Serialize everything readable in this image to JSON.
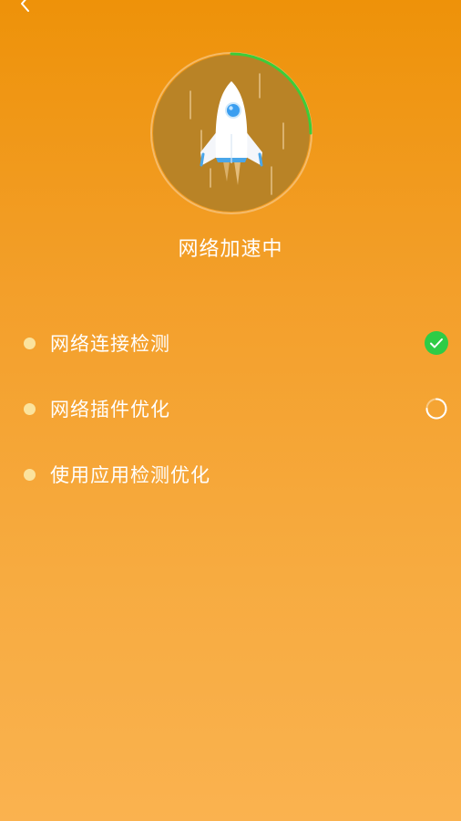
{
  "header": {
    "back_icon": "chevron-left-icon"
  },
  "hero": {
    "icon": "rocket-icon",
    "progress": 0.25,
    "progress_color": "#3dcc3a",
    "circle_color": "#b98326"
  },
  "status": {
    "title": "网络加速中"
  },
  "tasks": [
    {
      "label": "网络连接检测",
      "state": "done",
      "status_icon": "check-circle-icon"
    },
    {
      "label": "网络插件优化",
      "state": "in-progress",
      "status_icon": "loading-spinner-icon"
    },
    {
      "label": "使用应用检测优化",
      "state": "pending",
      "status_icon": ""
    }
  ],
  "colors": {
    "background_top": "#ee9209",
    "background_bottom": "#fab24f",
    "bullet": "#fbe39d",
    "done": "#2ecc46"
  }
}
